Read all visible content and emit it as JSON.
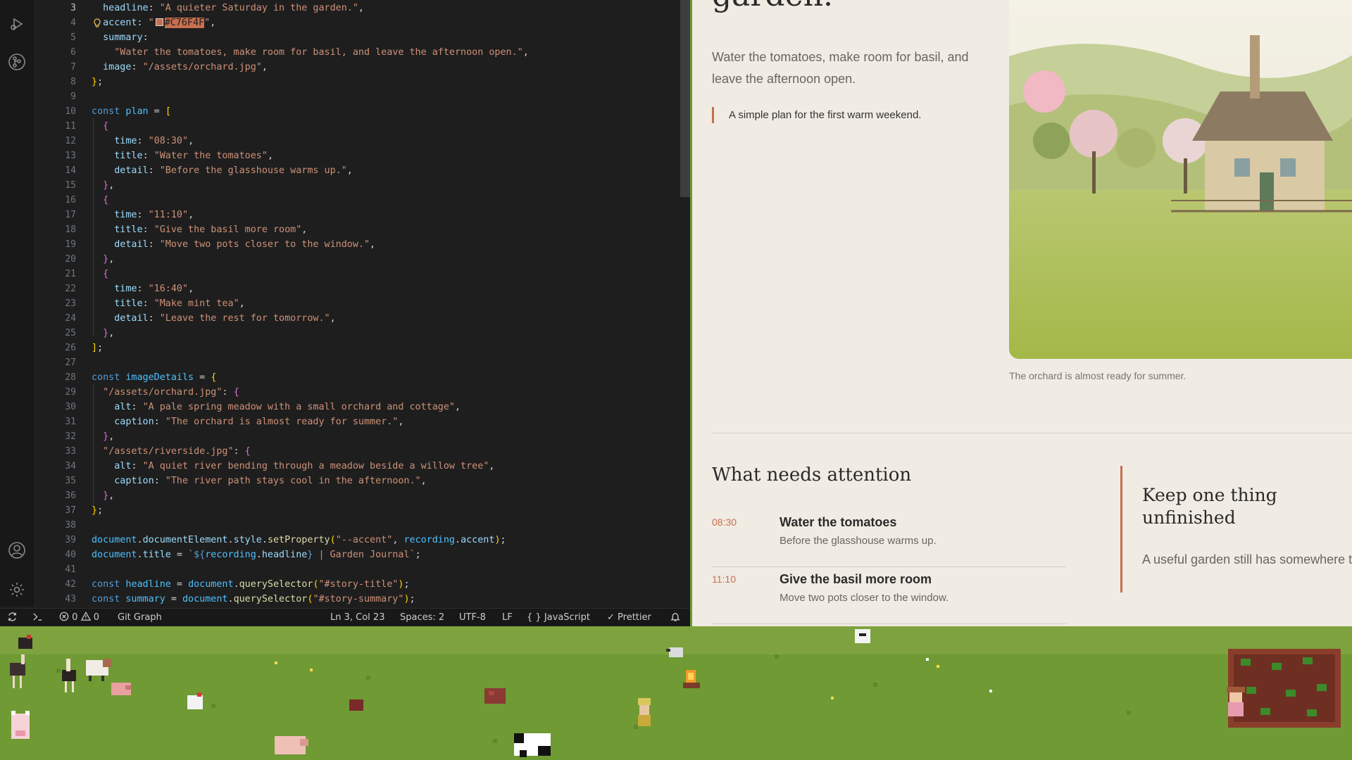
{
  "editor": {
    "current_line": 3,
    "lines": [
      {
        "n": 3,
        "tokens": [
          [
            "pr",
            "  headline"
          ],
          [
            "pu",
            ": "
          ],
          [
            "st",
            "\"A quieter Saturday in the garden.\""
          ],
          [
            "pu",
            ","
          ]
        ]
      },
      {
        "n": 4,
        "tokens": [
          [
            "pr",
            "  accent"
          ],
          [
            "pu",
            ": "
          ],
          [
            "st",
            "\""
          ],
          [
            "swatch",
            ""
          ],
          [
            "hl",
            "#C76F4F"
          ],
          [
            "st",
            "\""
          ],
          [
            "pu",
            ","
          ]
        ]
      },
      {
        "n": 5,
        "tokens": [
          [
            "pr",
            "  summary"
          ],
          [
            "pu",
            ":"
          ]
        ]
      },
      {
        "n": 6,
        "tokens": [
          [
            "st",
            "    \"Water the tomatoes, make room for basil, and leave the afternoon open.\""
          ],
          [
            "pu",
            ","
          ]
        ]
      },
      {
        "n": 7,
        "tokens": [
          [
            "pr",
            "  image"
          ],
          [
            "pu",
            ": "
          ],
          [
            "st",
            "\"/assets/orchard.jpg\""
          ],
          [
            "pu",
            ","
          ]
        ]
      },
      {
        "n": 8,
        "tokens": [
          [
            "b1",
            "}"
          ],
          [
            "pu",
            ";"
          ]
        ]
      },
      {
        "n": 9,
        "tokens": []
      },
      {
        "n": 10,
        "tokens": [
          [
            "kw",
            "const "
          ],
          [
            "vr",
            "plan"
          ],
          [
            "pu",
            " = "
          ],
          [
            "b1",
            "["
          ]
        ]
      },
      {
        "n": 11,
        "tokens": [
          [
            "b2",
            "  {"
          ]
        ]
      },
      {
        "n": 12,
        "tokens": [
          [
            "pr",
            "    time"
          ],
          [
            "pu",
            ": "
          ],
          [
            "st",
            "\"08:30\""
          ],
          [
            "pu",
            ","
          ]
        ]
      },
      {
        "n": 13,
        "tokens": [
          [
            "pr",
            "    title"
          ],
          [
            "pu",
            ": "
          ],
          [
            "st",
            "\"Water the tomatoes\""
          ],
          [
            "pu",
            ","
          ]
        ]
      },
      {
        "n": 14,
        "tokens": [
          [
            "pr",
            "    detail"
          ],
          [
            "pu",
            ": "
          ],
          [
            "st",
            "\"Before the glasshouse warms up.\""
          ],
          [
            "pu",
            ","
          ]
        ]
      },
      {
        "n": 15,
        "tokens": [
          [
            "b2",
            "  }"
          ],
          [
            "pu",
            ","
          ]
        ]
      },
      {
        "n": 16,
        "tokens": [
          [
            "b2",
            "  {"
          ]
        ]
      },
      {
        "n": 17,
        "tokens": [
          [
            "pr",
            "    time"
          ],
          [
            "pu",
            ": "
          ],
          [
            "st",
            "\"11:10\""
          ],
          [
            "pu",
            ","
          ]
        ]
      },
      {
        "n": 18,
        "tokens": [
          [
            "pr",
            "    title"
          ],
          [
            "pu",
            ": "
          ],
          [
            "st",
            "\"Give the basil more room\""
          ],
          [
            "pu",
            ","
          ]
        ]
      },
      {
        "n": 19,
        "tokens": [
          [
            "pr",
            "    detail"
          ],
          [
            "pu",
            ": "
          ],
          [
            "st",
            "\"Move two pots closer to the window.\""
          ],
          [
            "pu",
            ","
          ]
        ]
      },
      {
        "n": 20,
        "tokens": [
          [
            "b2",
            "  }"
          ],
          [
            "pu",
            ","
          ]
        ]
      },
      {
        "n": 21,
        "tokens": [
          [
            "b2",
            "  {"
          ]
        ]
      },
      {
        "n": 22,
        "tokens": [
          [
            "pr",
            "    time"
          ],
          [
            "pu",
            ": "
          ],
          [
            "st",
            "\"16:40\""
          ],
          [
            "pu",
            ","
          ]
        ]
      },
      {
        "n": 23,
        "tokens": [
          [
            "pr",
            "    title"
          ],
          [
            "pu",
            ": "
          ],
          [
            "st",
            "\"Make mint tea\""
          ],
          [
            "pu",
            ","
          ]
        ]
      },
      {
        "n": 24,
        "tokens": [
          [
            "pr",
            "    detail"
          ],
          [
            "pu",
            ": "
          ],
          [
            "st",
            "\"Leave the rest for tomorrow.\""
          ],
          [
            "pu",
            ","
          ]
        ]
      },
      {
        "n": 25,
        "tokens": [
          [
            "b2",
            "  }"
          ],
          [
            "pu",
            ","
          ]
        ]
      },
      {
        "n": 26,
        "tokens": [
          [
            "b1",
            "]"
          ],
          [
            "pu",
            ";"
          ]
        ]
      },
      {
        "n": 27,
        "tokens": []
      },
      {
        "n": 28,
        "tokens": [
          [
            "kw",
            "const "
          ],
          [
            "vr",
            "imageDetails"
          ],
          [
            "pu",
            " = "
          ],
          [
            "b1",
            "{"
          ]
        ]
      },
      {
        "n": 29,
        "tokens": [
          [
            "st",
            "  \"/assets/orchard.jpg\""
          ],
          [
            "pu",
            ": "
          ],
          [
            "b2",
            "{"
          ]
        ]
      },
      {
        "n": 30,
        "tokens": [
          [
            "pr",
            "    alt"
          ],
          [
            "pu",
            ": "
          ],
          [
            "st",
            "\"A pale spring meadow with a small orchard and cottage\""
          ],
          [
            "pu",
            ","
          ]
        ]
      },
      {
        "n": 31,
        "tokens": [
          [
            "pr",
            "    caption"
          ],
          [
            "pu",
            ": "
          ],
          [
            "st",
            "\"The orchard is almost ready for summer.\""
          ],
          [
            "pu",
            ","
          ]
        ]
      },
      {
        "n": 32,
        "tokens": [
          [
            "b2",
            "  }"
          ],
          [
            "pu",
            ","
          ]
        ]
      },
      {
        "n": 33,
        "tokens": [
          [
            "st",
            "  \"/assets/riverside.jpg\""
          ],
          [
            "pu",
            ": "
          ],
          [
            "b2",
            "{"
          ]
        ]
      },
      {
        "n": 34,
        "tokens": [
          [
            "pr",
            "    alt"
          ],
          [
            "pu",
            ": "
          ],
          [
            "st",
            "\"A quiet river bending through a meadow beside a willow tree\""
          ],
          [
            "pu",
            ","
          ]
        ]
      },
      {
        "n": 35,
        "tokens": [
          [
            "pr",
            "    caption"
          ],
          [
            "pu",
            ": "
          ],
          [
            "st",
            "\"The river path stays cool in the afternoon.\""
          ],
          [
            "pu",
            ","
          ]
        ]
      },
      {
        "n": 36,
        "tokens": [
          [
            "b2",
            "  }"
          ],
          [
            "pu",
            ","
          ]
        ]
      },
      {
        "n": 37,
        "tokens": [
          [
            "b1",
            "}"
          ],
          [
            "pu",
            ";"
          ]
        ]
      },
      {
        "n": 38,
        "tokens": []
      },
      {
        "n": 39,
        "tokens": [
          [
            "vr",
            "document"
          ],
          [
            "pu",
            "."
          ],
          [
            "pr",
            "documentElement"
          ],
          [
            "pu",
            "."
          ],
          [
            "pr",
            "style"
          ],
          [
            "pu",
            "."
          ],
          [
            "fn",
            "setProperty"
          ],
          [
            "b1",
            "("
          ],
          [
            "st",
            "\"--accent\""
          ],
          [
            "pu",
            ", "
          ],
          [
            "vr",
            "recording"
          ],
          [
            "pu",
            "."
          ],
          [
            "pr",
            "accent"
          ],
          [
            "b1",
            ")"
          ],
          [
            "pu",
            ";"
          ]
        ]
      },
      {
        "n": 40,
        "tokens": [
          [
            "vr",
            "document"
          ],
          [
            "pu",
            "."
          ],
          [
            "pr",
            "title"
          ],
          [
            "pu",
            " = "
          ],
          [
            "st",
            "`"
          ],
          [
            "kw",
            "${"
          ],
          [
            "vr",
            "recording"
          ],
          [
            "pu",
            "."
          ],
          [
            "pr",
            "headline"
          ],
          [
            "kw",
            "}"
          ],
          [
            "st",
            " | Garden Journal`"
          ],
          [
            "pu",
            ";"
          ]
        ]
      },
      {
        "n": 41,
        "tokens": []
      },
      {
        "n": 42,
        "tokens": [
          [
            "kw",
            "const "
          ],
          [
            "vr",
            "headline"
          ],
          [
            "pu",
            " = "
          ],
          [
            "vr",
            "document"
          ],
          [
            "pu",
            "."
          ],
          [
            "fn",
            "querySelector"
          ],
          [
            "b1",
            "("
          ],
          [
            "st",
            "\"#story-title\""
          ],
          [
            "b1",
            ")"
          ],
          [
            "pu",
            ";"
          ]
        ]
      },
      {
        "n": 43,
        "tokens": [
          [
            "kw",
            "const "
          ],
          [
            "vr",
            "summary"
          ],
          [
            "pu",
            " = "
          ],
          [
            "vr",
            "document"
          ],
          [
            "pu",
            "."
          ],
          [
            "fn",
            "querySelector"
          ],
          [
            "b1",
            "("
          ],
          [
            "st",
            "\"#story-summary\""
          ],
          [
            "b1",
            ")"
          ],
          [
            "pu",
            ";"
          ]
        ]
      }
    ]
  },
  "statusbar": {
    "errors": "0",
    "warnings": "0",
    "git_graph": "Git Graph",
    "cursor": "Ln 3, Col 23",
    "spaces": "Spaces: 2",
    "encoding": "UTF-8",
    "eol": "LF",
    "language": "JavaScript",
    "formatter": "Prettier"
  },
  "preview": {
    "headline": "garden.",
    "summary": "Water the tomatoes, make room for basil, and leave the afternoon open.",
    "quote": "A simple plan for the first warm weekend.",
    "image_caption": "The orchard is almost ready for summer.",
    "attention_title": "What needs attention",
    "plan": [
      {
        "time": "08:30",
        "title": "Water the tomatoes",
        "detail": "Before the glasshouse warms up."
      },
      {
        "time": "11:10",
        "title": "Give the basil more room",
        "detail": "Move two pots closer to the window."
      }
    ],
    "aside_title": "Keep one thing unfinished",
    "aside_text": "A useful garden still has somewhere to return to tomorrow."
  },
  "colors": {
    "accent": "#C76F4F",
    "editor_bg": "#1e1e1e",
    "preview_bg": "#f0ebe3",
    "meadow": "#6f9a34"
  },
  "icons": [
    "run-debug-icon",
    "git-graph-icon",
    "account-icon",
    "settings-gear-icon",
    "sync-icon",
    "remote-icon",
    "error-icon",
    "warning-icon",
    "braces-icon",
    "check-icon",
    "bell-icon",
    "lightbulb-icon"
  ]
}
